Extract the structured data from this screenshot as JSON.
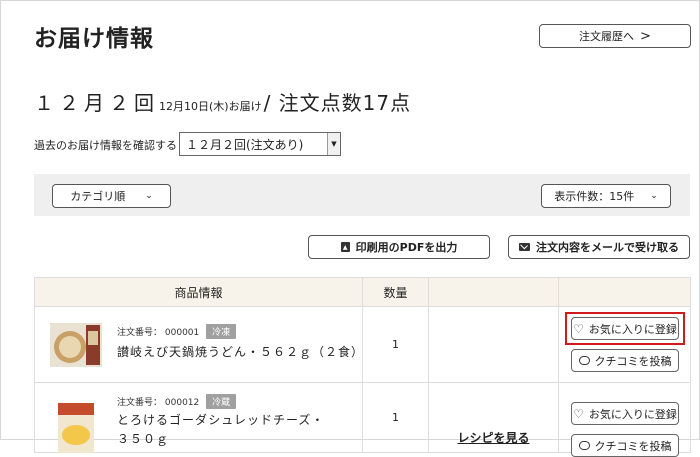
{
  "header": {
    "title": "お届け情報",
    "history_button": "注文履歴へ",
    "history_chevron": ">"
  },
  "delivery": {
    "round": "１２月２回",
    "date": "12月10日(木)お届け",
    "count": "/ 注文点数17点"
  },
  "past": {
    "label": "過去のお届け情報を確認する",
    "selected": "１２月２回(注文あり)"
  },
  "filters": {
    "category": "カテゴリ順",
    "per_page": "表示件数：15件"
  },
  "actions": {
    "pdf": "印刷用のPDFを出力",
    "mail": "注文内容をメールで受け取る"
  },
  "table": {
    "headers": [
      "商品情報",
      "数量",
      "",
      ""
    ],
    "rows": [
      {
        "order_label": "注文番号：",
        "order_no": "000001",
        "tag": "冷凍",
        "name": "讃岐えび天鍋焼うどん・５６２ｇ（２食）",
        "qty": "1",
        "recipe": "",
        "favorite": "お気に入りに登録",
        "review": "クチコミを投稿"
      },
      {
        "order_label": "注文番号：",
        "order_no": "000012",
        "tag": "冷蔵",
        "name_line1": "とろけるゴーダシュレッドチーズ・",
        "name_line2": "３５０ｇ",
        "qty": "1",
        "recipe": "レシピを見る",
        "favorite": "お気に入りに登録",
        "review": "クチコミを投稿"
      }
    ]
  },
  "colors": {
    "highlight": "#d11a1a",
    "header_bg": "#f8f3ea",
    "filter_bg": "#efefef"
  },
  "icons": [
    "pdf-icon",
    "mail-icon",
    "chevron-down-icon",
    "chevron-right-icon",
    "heart-icon",
    "speech-bubble-icon"
  ]
}
